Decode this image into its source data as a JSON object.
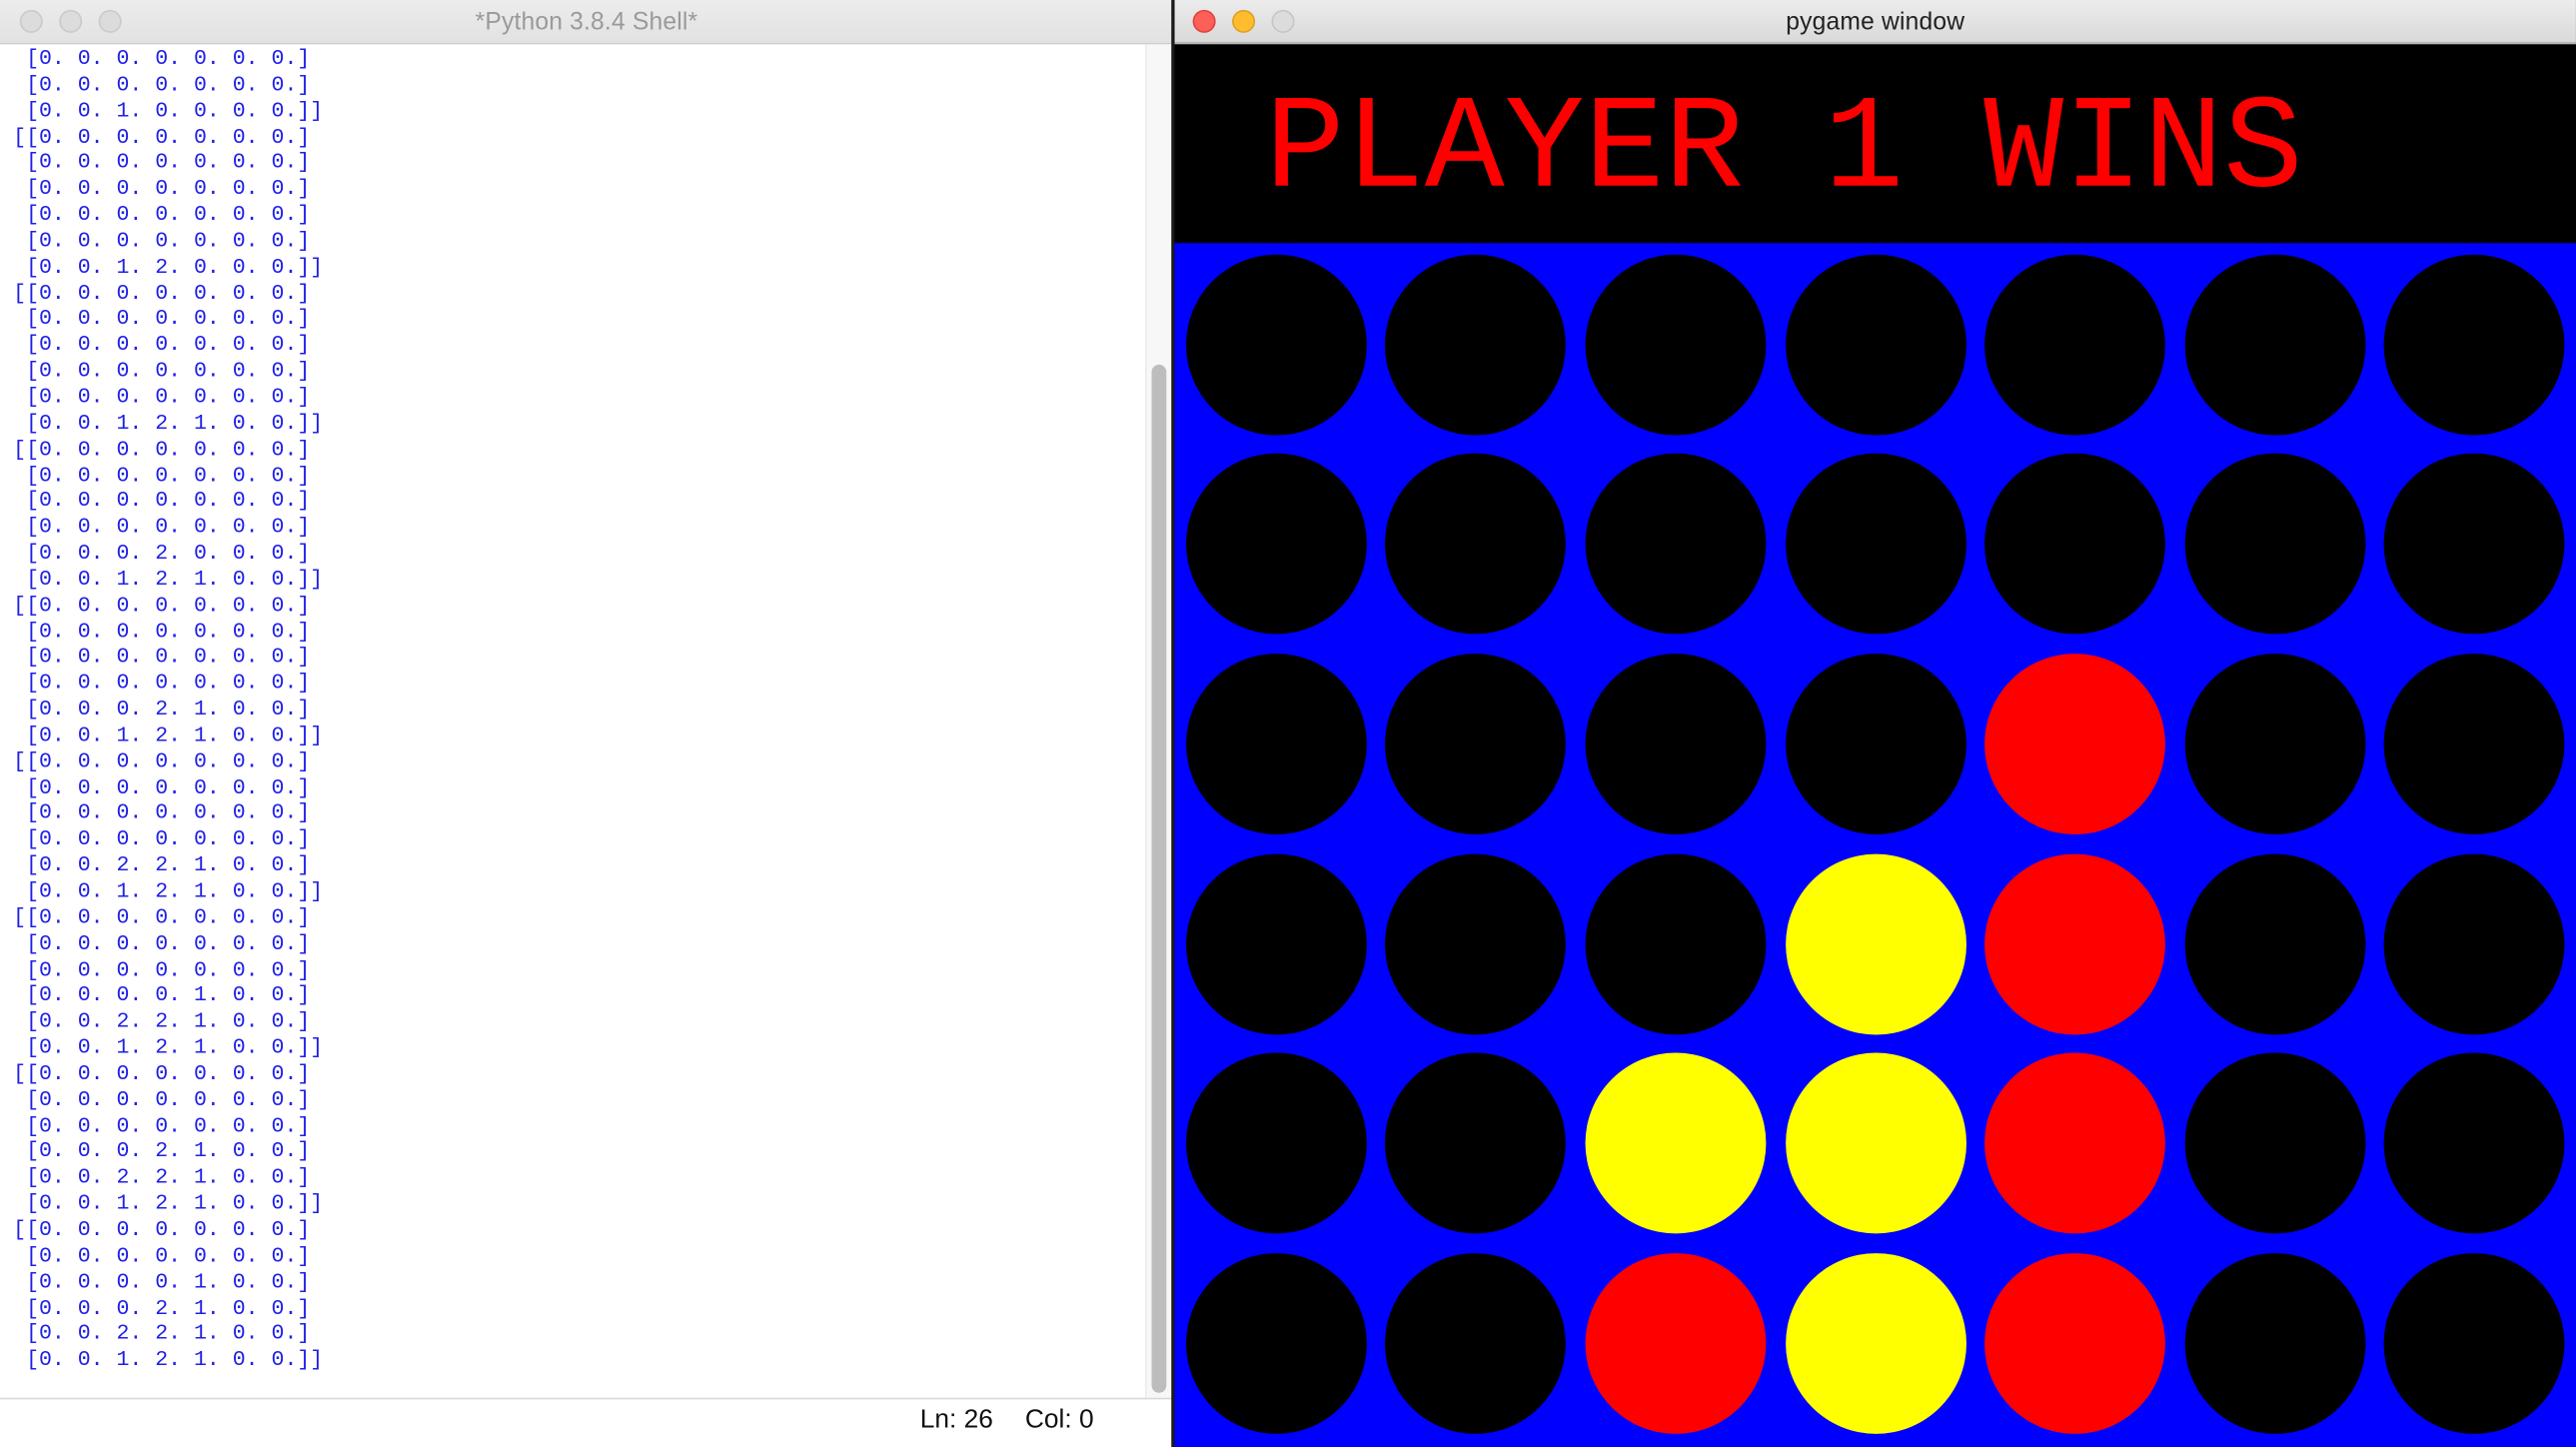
{
  "shell_window": {
    "title": "*Python 3.8.4 Shell*",
    "lines": [
      " [0. 0. 0. 0. 0. 0. 0.]",
      " [0. 0. 0. 0. 0. 0. 0.]",
      " [0. 0. 1. 0. 0. 0. 0.]]",
      "[[0. 0. 0. 0. 0. 0. 0.]",
      " [0. 0. 0. 0. 0. 0. 0.]",
      " [0. 0. 0. 0. 0. 0. 0.]",
      " [0. 0. 0. 0. 0. 0. 0.]",
      " [0. 0. 0. 0. 0. 0. 0.]",
      " [0. 0. 1. 2. 0. 0. 0.]]",
      "[[0. 0. 0. 0. 0. 0. 0.]",
      " [0. 0. 0. 0. 0. 0. 0.]",
      " [0. 0. 0. 0. 0. 0. 0.]",
      " [0. 0. 0. 0. 0. 0. 0.]",
      " [0. 0. 0. 0. 0. 0. 0.]",
      " [0. 0. 1. 2. 1. 0. 0.]]",
      "[[0. 0. 0. 0. 0. 0. 0.]",
      " [0. 0. 0. 0. 0. 0. 0.]",
      " [0. 0. 0. 0. 0. 0. 0.]",
      " [0. 0. 0. 0. 0. 0. 0.]",
      " [0. 0. 0. 2. 0. 0. 0.]",
      " [0. 0. 1. 2. 1. 0. 0.]]",
      "[[0. 0. 0. 0. 0. 0. 0.]",
      " [0. 0. 0. 0. 0. 0. 0.]",
      " [0. 0. 0. 0. 0. 0. 0.]",
      " [0. 0. 0. 0. 0. 0. 0.]",
      " [0. 0. 0. 2. 1. 0. 0.]",
      " [0. 0. 1. 2. 1. 0. 0.]]",
      "[[0. 0. 0. 0. 0. 0. 0.]",
      " [0. 0. 0. 0. 0. 0. 0.]",
      " [0. 0. 0. 0. 0. 0. 0.]",
      " [0. 0. 0. 0. 0. 0. 0.]",
      " [0. 0. 2. 2. 1. 0. 0.]",
      " [0. 0. 1. 2. 1. 0. 0.]]",
      "[[0. 0. 0. 0. 0. 0. 0.]",
      " [0. 0. 0. 0. 0. 0. 0.]",
      " [0. 0. 0. 0. 0. 0. 0.]",
      " [0. 0. 0. 0. 1. 0. 0.]",
      " [0. 0. 2. 2. 1. 0. 0.]",
      " [0. 0. 1. 2. 1. 0. 0.]]",
      "[[0. 0. 0. 0. 0. 0. 0.]",
      " [0. 0. 0. 0. 0. 0. 0.]",
      " [0. 0. 0. 0. 0. 0. 0.]",
      " [0. 0. 0. 2. 1. 0. 0.]",
      " [0. 0. 2. 2. 1. 0. 0.]",
      " [0. 0. 1. 2. 1. 0. 0.]]",
      "[[0. 0. 0. 0. 0. 0. 0.]",
      " [0. 0. 0. 0. 0. 0. 0.]",
      " [0. 0. 0. 0. 1. 0. 0.]",
      " [0. 0. 0. 2. 1. 0. 0.]",
      " [0. 0. 2. 2. 1. 0. 0.]",
      " [0. 0. 1. 2. 1. 0. 0.]]"
    ],
    "status": {
      "line": "Ln: 26",
      "column": "Col: 0"
    }
  },
  "pygame_window": {
    "title": "pygame window",
    "message": "PLAYER 1 WINS",
    "board": [
      [
        "empty",
        "empty",
        "empty",
        "empty",
        "empty",
        "empty",
        "empty"
      ],
      [
        "empty",
        "empty",
        "empty",
        "empty",
        "empty",
        "empty",
        "empty"
      ],
      [
        "empty",
        "empty",
        "empty",
        "empty",
        "red",
        "empty",
        "empty"
      ],
      [
        "empty",
        "empty",
        "empty",
        "yellow",
        "red",
        "empty",
        "empty"
      ],
      [
        "empty",
        "empty",
        "yellow",
        "yellow",
        "red",
        "empty",
        "empty"
      ],
      [
        "empty",
        "empty",
        "red",
        "yellow",
        "red",
        "empty",
        "empty"
      ]
    ]
  },
  "colors": {
    "board": "#0000ff",
    "empty": "#000000",
    "red": "#ff0000",
    "yellow": "#ffff00",
    "message": "#ff0000",
    "shell_text": "#2020e6"
  }
}
